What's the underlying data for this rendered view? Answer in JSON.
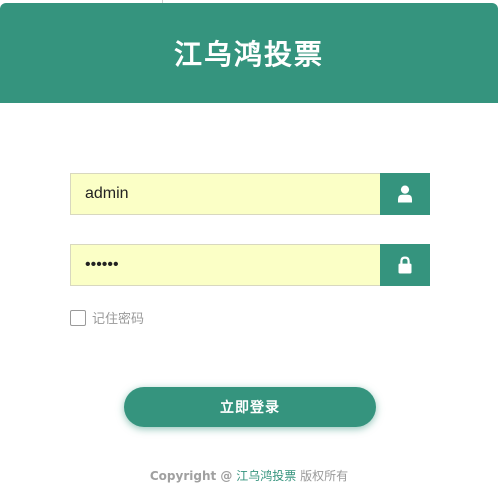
{
  "header": {
    "title": "江乌鸿投票",
    "color": "#35947e"
  },
  "login": {
    "username": {
      "value": "admin",
      "icon": "user-icon"
    },
    "password": {
      "value": "123456",
      "icon": "lock-icon"
    },
    "remember_label": "记住密码",
    "remember_checked": false,
    "submit_label": "立即登录",
    "input_background": "#fbffc6"
  },
  "footer": {
    "copyright": "Copyright @",
    "link_text": "江乌鸿投票",
    "rights": "版权所有"
  }
}
